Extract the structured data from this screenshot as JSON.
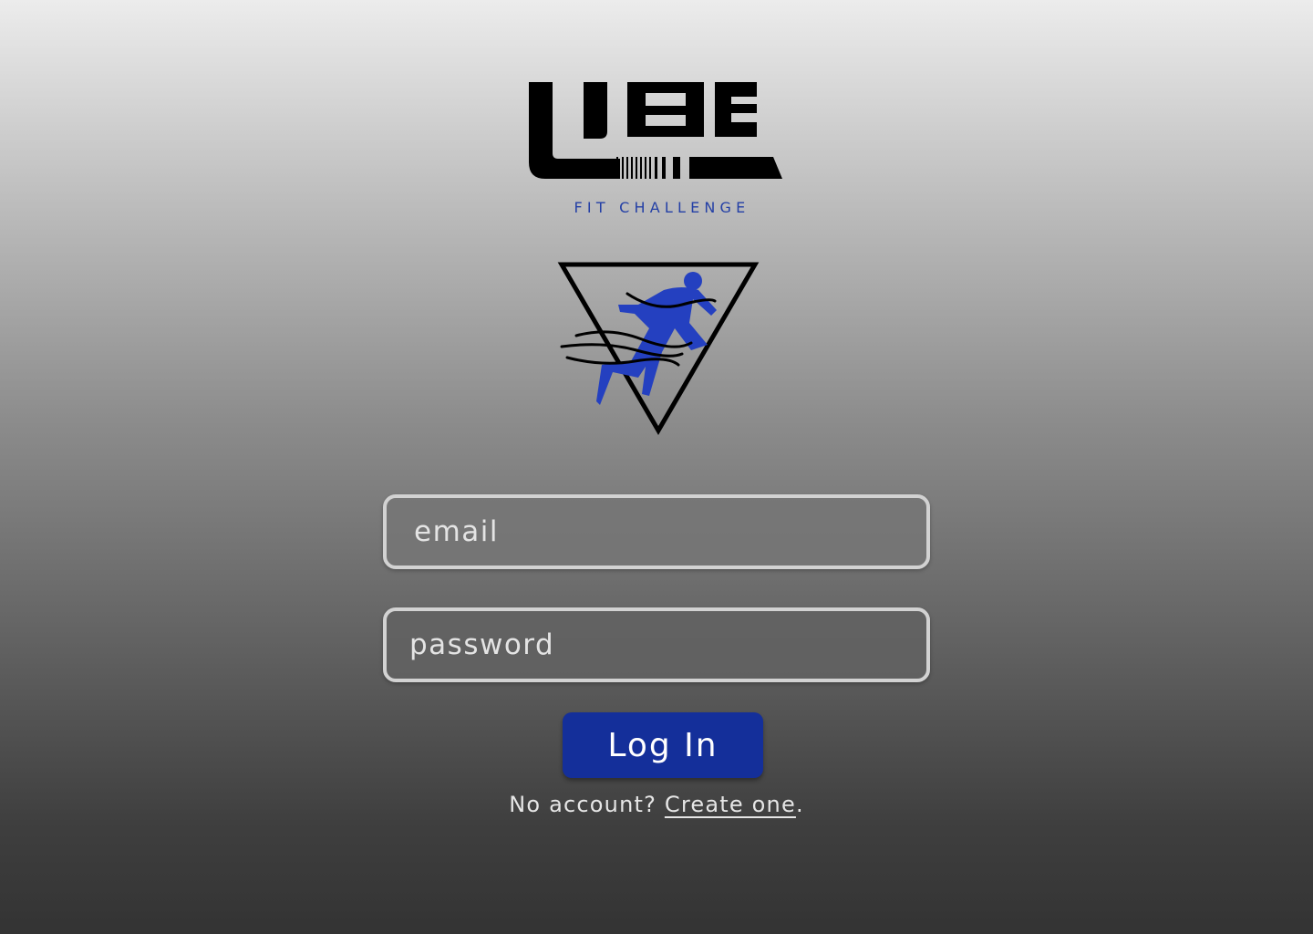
{
  "brand": {
    "logo_text": "UBE",
    "tagline": "FIT CHALLENGE",
    "logo_color": "#000000",
    "accent_color": "#2440a6",
    "emblem_icon": "sprinter-triangle-icon"
  },
  "form": {
    "email_placeholder": "email",
    "email_value": "",
    "password_placeholder": "password",
    "password_value": "",
    "login_label": "Log In",
    "login_color": "#142f9a"
  },
  "signup": {
    "prompt": "No account?",
    "link_label": "Create one",
    "trailing": "."
  }
}
